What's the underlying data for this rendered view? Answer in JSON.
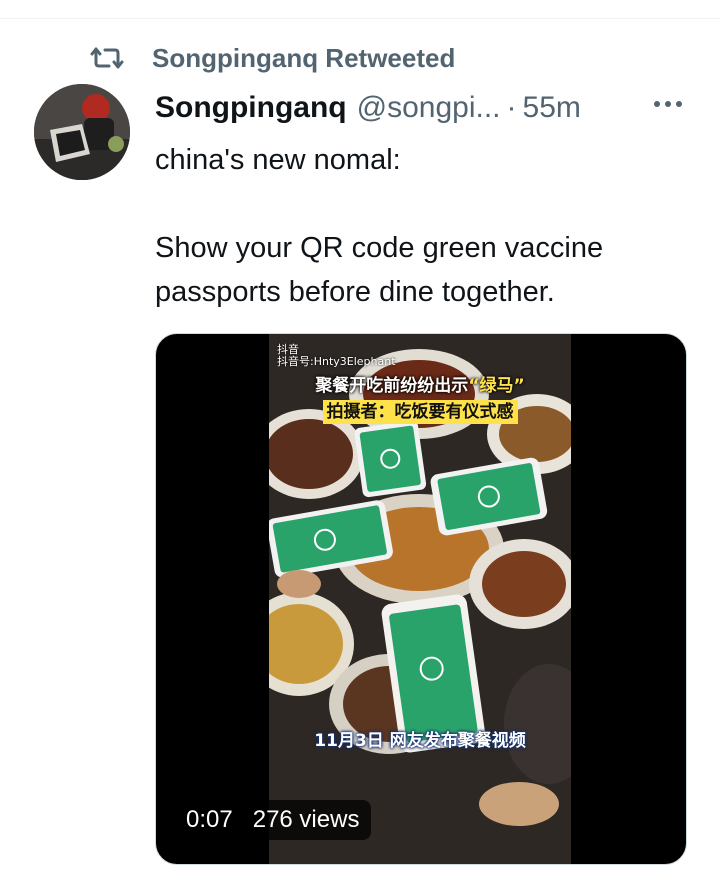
{
  "retweet": {
    "label": "Songpinganq Retweeted",
    "icon": "retweet-icon"
  },
  "author": {
    "display_name": "Songpinganq",
    "handle": "@songpi...",
    "separator": "·",
    "timestamp": "55m",
    "avatar_icon": "avatar-photo"
  },
  "tweet": {
    "line1": "china's new nomal:",
    "line2": "Show your QR code green vaccine",
    "line3": "passports before dine together."
  },
  "video": {
    "watermark_line1": "抖音",
    "watermark_line2": "抖音号:Hnty3Elephant",
    "caption_line1_pre": "聚餐开吃前纷纷出示",
    "caption_line1_quote": "“绿马”",
    "caption_line2": "拍摄者：吃饭要有仪式感",
    "caption_bottom": "11月3日 网友发布聚餐视频",
    "duration": "0:07",
    "views": "276 views"
  },
  "colors": {
    "secondary_text": "#536471",
    "primary_text": "#0f1419",
    "media_border": "#cfd9de",
    "green_pass": "#2aa36b"
  }
}
